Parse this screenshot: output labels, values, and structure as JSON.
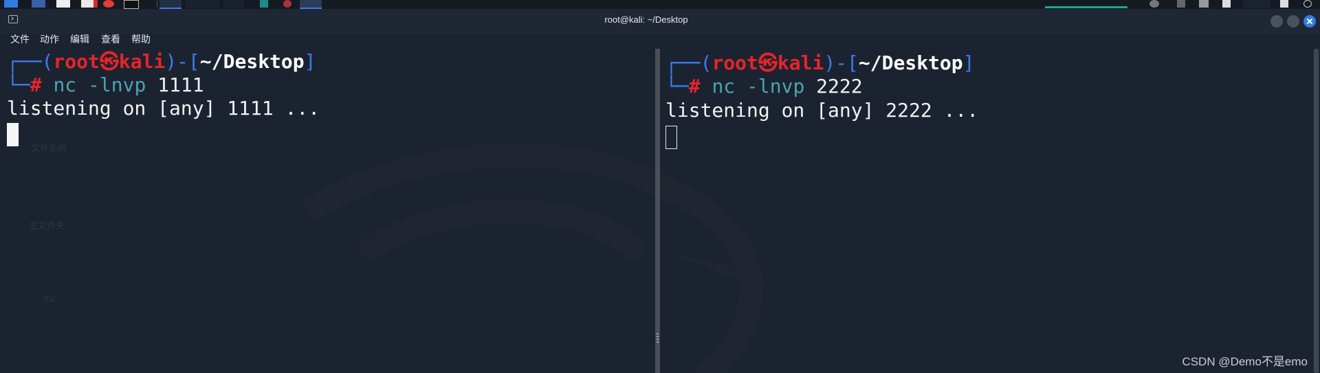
{
  "window": {
    "title": "root@kali: ~/Desktop"
  },
  "menu": [
    "文件",
    "动作",
    "编辑",
    "查看",
    "帮助"
  ],
  "panes": [
    {
      "prompt_user": "root",
      "prompt_sep": "㉿",
      "prompt_host": "kali",
      "prompt_dir": "~/Desktop",
      "prompt_symbol": "#",
      "command": "nc",
      "command_args": "-lnvp",
      "command_port": "1111",
      "output": "listening on [any] 1111 ..."
    },
    {
      "prompt_user": "root",
      "prompt_sep": "㉿",
      "prompt_host": "kali",
      "prompt_dir": "~/Desktop",
      "prompt_symbol": "#",
      "command": "nc",
      "command_args": "-lnvp",
      "command_port": "2222",
      "output": "listening on [any] 2222 ..."
    }
  ],
  "desktop_ghost_labels": [
    "文件系统",
    "主文件夹",
    "mc"
  ],
  "watermark": "CSDN @Demo不是emo",
  "colors": {
    "prompt_frame": "#3a7bf0",
    "prompt_user_host": "#e8242a",
    "command": "#4aa4b4",
    "close_button": "#2f7de1"
  }
}
